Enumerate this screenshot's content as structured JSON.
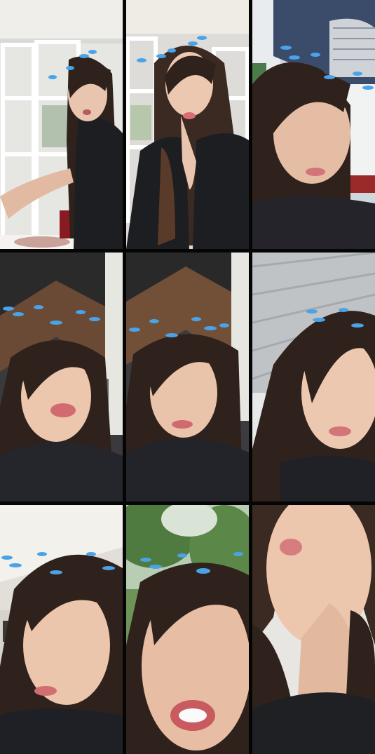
{
  "layout": {
    "columns": 3,
    "rows": 3
  },
  "tiles": [
    {
      "scene": "indoor-white-window-frames",
      "face": "front",
      "effect": "blue-bird-crown"
    },
    {
      "scene": "indoor-white-window-frames",
      "face": "front",
      "effect": "blue-bird-crown"
    },
    {
      "scene": "outdoor-building-awning",
      "face": "tilted",
      "effect": "blue-bird-crown"
    },
    {
      "scene": "wooden-gable-roof",
      "face": "front",
      "effect": "blue-bird-crown"
    },
    {
      "scene": "wooden-gable-roof",
      "face": "front",
      "effect": "blue-bird-crown"
    },
    {
      "scene": "metal-ceiling",
      "face": "side",
      "effect": "blue-bird-crown"
    },
    {
      "scene": "white-ceiling-indoor",
      "face": "eyes-closed",
      "effect": "blue-bird-crown"
    },
    {
      "scene": "green-trees-outdoor",
      "face": "closeup",
      "effect": "blue-bird-crown"
    },
    {
      "scene": "white-wall",
      "face": "looking-up",
      "effect": "none"
    }
  ],
  "colors": {
    "skin": "#e9c4ae",
    "hair": "#2f221c",
    "shirt": "#1d1e22",
    "bird": "#4aa3e8",
    "lips": "#d86e72",
    "divider": "#050505"
  }
}
